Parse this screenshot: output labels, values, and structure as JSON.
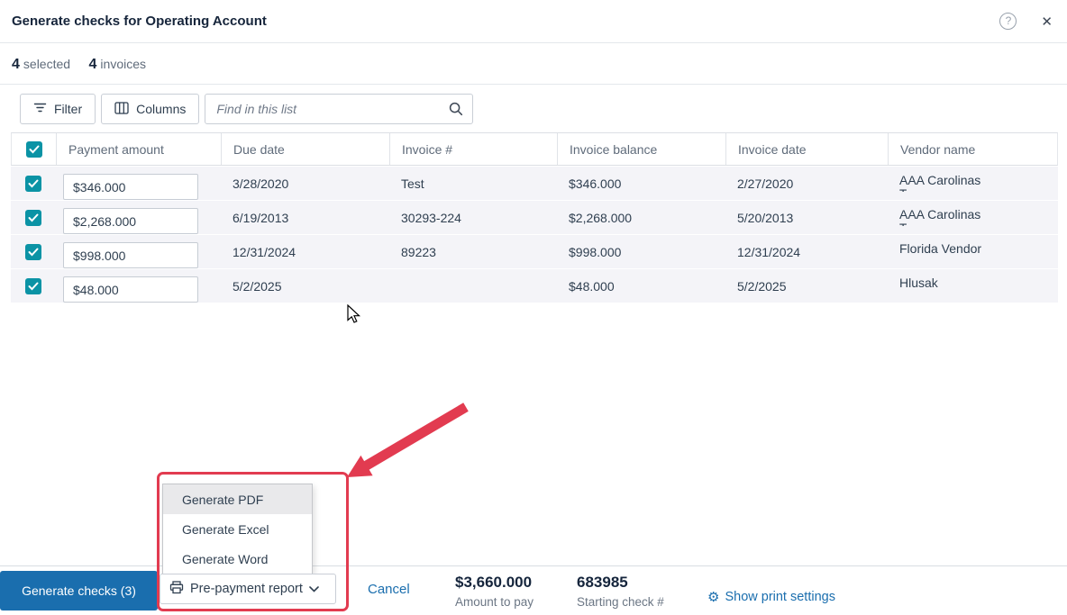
{
  "header": {
    "title": "Generate checks for Operating Account",
    "help_icon": "?",
    "close_icon": "✕"
  },
  "summary": {
    "selected_count": "4",
    "selected_label": "selected",
    "invoices_count": "4",
    "invoices_label": "invoices"
  },
  "toolbar": {
    "filter_label": "Filter",
    "columns_label": "Columns",
    "search_placeholder": "Find in this list"
  },
  "table": {
    "columns": {
      "payment_amount": "Payment amount",
      "due_date": "Due date",
      "invoice_num": "Invoice #",
      "invoice_balance": "Invoice balance",
      "invoice_date": "Invoice date",
      "vendor_name": "Vendor name"
    },
    "rows": [
      {
        "checked": true,
        "payment_amount": "$346.000",
        "due_date": "3/28/2020",
        "invoice_num": "Test",
        "invoice_balance": "$346.000",
        "invoice_date": "2/27/2020",
        "vendor": "AAA Carolinas",
        "vendor_line2": "T"
      },
      {
        "checked": true,
        "payment_amount": "$2,268.000",
        "due_date": "6/19/2013",
        "invoice_num": "30293-224",
        "invoice_balance": "$2,268.000",
        "invoice_date": "5/20/2013",
        "vendor": "AAA Carolinas",
        "vendor_line2": "T"
      },
      {
        "checked": true,
        "payment_amount": "$998.000",
        "due_date": "12/31/2024",
        "invoice_num": "89223",
        "invoice_balance": "$998.000",
        "invoice_date": "12/31/2024",
        "vendor": "Florida Vendor",
        "vendor_line2": ""
      },
      {
        "checked": true,
        "payment_amount": "$48.000",
        "due_date": "5/2/2025",
        "invoice_num": "",
        "invoice_balance": "$48.000",
        "invoice_date": "5/2/2025",
        "vendor": "Hlusak",
        "vendor_line2": ""
      }
    ]
  },
  "menu": {
    "items": [
      "Generate PDF",
      "Generate Excel",
      "Generate Word"
    ],
    "highlighted_item": "Generate PDF",
    "button_label": "Pre-payment report"
  },
  "footer": {
    "generate_label": "Generate checks (3)",
    "cancel_label": "Cancel",
    "amount_value": "$3,660.000",
    "amount_label": "Amount to pay",
    "check_value": "683985",
    "check_label": "Starting check #",
    "print_settings_label": "Show print settings",
    "gear_icon": "⚙"
  },
  "colors": {
    "accent_teal": "#0b93a5",
    "primary_blue": "#1a6eae",
    "annotation_red": "#e23b50",
    "row_background": "#f4f4f8"
  }
}
